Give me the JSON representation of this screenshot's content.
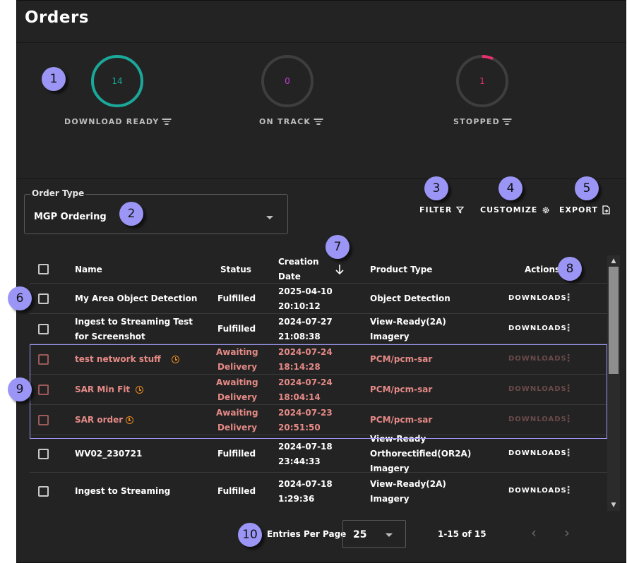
{
  "page": {
    "title": "Orders"
  },
  "summary": [
    {
      "count": "14",
      "label": "DOWNLOAD READY",
      "color": "#1aa89a",
      "fraction": 1.0
    },
    {
      "count": "0",
      "label": "ON TRACK",
      "color": "#c43bd6",
      "fraction": 0.0
    },
    {
      "count": "1",
      "label": "STOPPED",
      "color": "#e6306b",
      "fraction": 0.07
    }
  ],
  "order_type": {
    "label": "Order Type",
    "value": "MGP Ordering"
  },
  "toolbar": {
    "filter": "FILTER",
    "customize": "CUSTOMIZE",
    "export": "EXPORT"
  },
  "table": {
    "headers": {
      "name": "Name",
      "status": "Status",
      "creation_line1": "Creation",
      "creation_line2": "Date",
      "product_type": "Product Type",
      "actions": "Actions"
    },
    "download_label": "DOWNLOADS",
    "rows": [
      {
        "name1": "My Area Object Detection",
        "name2": "",
        "status1": "Fulfilled",
        "status2": "",
        "date1": "2025-04-10",
        "date2": "20:10:12",
        "prod1": "Object Detection",
        "prod2": "",
        "prod3": ""
      },
      {
        "name1": "Ingest to Streaming Test",
        "name2": "for Screenshot",
        "status1": "Fulfilled",
        "status2": "",
        "date1": "2024-07-27",
        "date2": "21:08:38",
        "prod1": "View-Ready(2A)",
        "prod2": "Imagery",
        "prod3": ""
      },
      {
        "name1": "test network stuff",
        "name2": "",
        "status1": "Awaiting",
        "status2": "Delivery",
        "date1": "2024-07-24",
        "date2": "18:14:28",
        "prod1": "PCM/pcm-sar",
        "prod2": "",
        "prod3": ""
      },
      {
        "name1": "SAR Min Fit",
        "name2": "",
        "status1": "Awaiting",
        "status2": "Delivery",
        "date1": "2024-07-24",
        "date2": "18:04:14",
        "prod1": "PCM/pcm-sar",
        "prod2": "",
        "prod3": ""
      },
      {
        "name1": "SAR order",
        "name2": "",
        "status1": "Awaiting",
        "status2": "Delivery",
        "date1": "2024-07-23",
        "date2": "20:51:50",
        "prod1": "PCM/pcm-sar",
        "prod2": "",
        "prod3": ""
      },
      {
        "name1": "WV02_230721",
        "name2": "",
        "status1": "Fulfilled",
        "status2": "",
        "date1": "2024-07-18",
        "date2": "23:44:33",
        "prod1": "View-Ready",
        "prod2": "Orthorectified(OR2A)",
        "prod3": "Imagery"
      },
      {
        "name1": "Ingest to Streaming",
        "name2": "",
        "status1": "Fulfilled",
        "status2": "",
        "date1": "2024-07-18",
        "date2": "1:29:36",
        "prod1": "View-Ready(2A)",
        "prod2": "Imagery",
        "prod3": ""
      }
    ]
  },
  "pagination": {
    "entries_label": "Entries Per Page",
    "per_page": "25",
    "range": "1-15 of 15"
  },
  "callouts": [
    "1",
    "2",
    "3",
    "4",
    "5",
    "6",
    "7",
    "8",
    "9",
    "10"
  ]
}
